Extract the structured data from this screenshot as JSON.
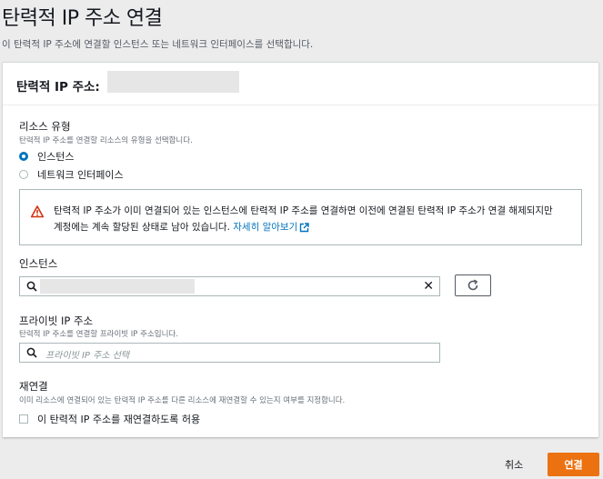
{
  "page": {
    "title": "탄력적 IP 주소 연결",
    "description": "이 탄력적 IP 주소에 연결할 인스턴스 또는 네트워크 인터페이스를 선택합니다."
  },
  "card": {
    "title": "탄력적 IP 주소:"
  },
  "resource_type": {
    "label": "리소스 유형",
    "description": "탄력적 IP 주소를 연결할 리소스의 유형을 선택합니다.",
    "options": [
      "인스턴스",
      "네트워크 인터페이스"
    ],
    "selected": "인스턴스"
  },
  "alert": {
    "text": "탄력적 IP 주소가 이미 연결되어 있는 인스턴스에 탄력적 IP 주소를 연결하면 이전에 연결된 탄력적 IP 주소가 연결 해제되지만 계정에는 계속 할당된 상태로 남아 있습니다. ",
    "link": "자세히 알아보기",
    "icon": "warning-icon",
    "color": "#d13212"
  },
  "instance": {
    "label": "인스턴스"
  },
  "private_ip": {
    "label": "프라이빗 IP 주소",
    "description": "탄력적 IP 주소를 연결할 프라이빗 IP 주소입니다.",
    "placeholder": "프라이빗 IP 주소 선택"
  },
  "reassociation": {
    "label": "재연결",
    "description": "이미 리소스에 연결되어 있는 탄력적 IP 주소를 다른 리소스에 재연결할 수 있는지 여부를 지정합니다.",
    "checkbox_label": "이 탄력적 IP 주소를 재연결하도록 허용",
    "checked": false
  },
  "footer": {
    "cancel": "취소",
    "submit": "연결"
  },
  "colors": {
    "accent": "#0073bb",
    "primary_button": "#ec7211",
    "warning": "#d13212"
  }
}
